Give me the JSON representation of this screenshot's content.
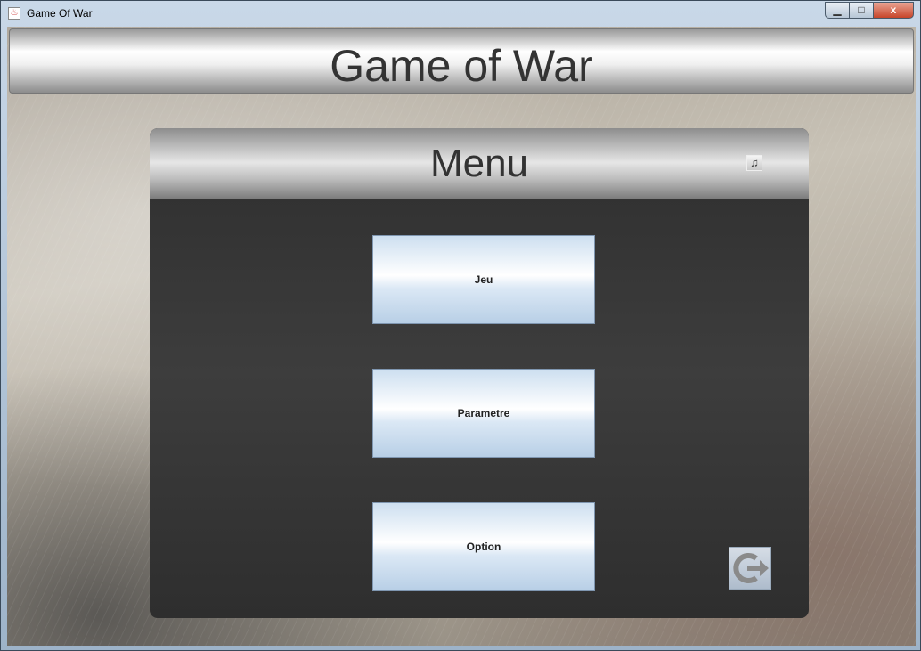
{
  "window": {
    "title": "Game Of War",
    "controls": {
      "minimize": "▁",
      "maximize": "□",
      "close": "x"
    }
  },
  "header": {
    "title": "Game of War"
  },
  "menu": {
    "title": "Menu",
    "music_icon": "music-note-icon",
    "buttons": [
      {
        "label": "Jeu"
      },
      {
        "label": "Parametre"
      },
      {
        "label": "Option"
      }
    ],
    "exit_icon": "exit-icon"
  }
}
